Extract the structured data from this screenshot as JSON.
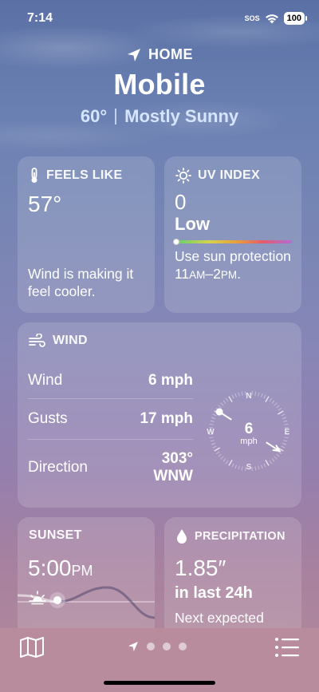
{
  "status_bar": {
    "time": "7:14",
    "sos": "SOS",
    "battery": "100"
  },
  "header": {
    "location_label": "HOME",
    "city": "Mobile",
    "temperature": "60°",
    "condition": "Mostly Sunny"
  },
  "feels_like": {
    "title": "FEELS LIKE",
    "value": "57°",
    "description": "Wind is making it feel cooler."
  },
  "uv_index": {
    "title": "UV INDEX",
    "value": "0",
    "level": "Low",
    "level_fraction": 0,
    "description_line1": "Use sun protection",
    "time_start": "11",
    "time_start_suffix": "AM",
    "dash": "–",
    "time_end": "2",
    "time_end_suffix": "PM",
    "period": "."
  },
  "wind": {
    "title": "WIND",
    "rows": [
      {
        "label": "Wind",
        "value": "6 mph"
      },
      {
        "label": "Gusts",
        "value": "17 mph"
      },
      {
        "label": "Direction",
        "value": "303°",
        "value2": "WNW"
      }
    ],
    "compass": {
      "speed": "6",
      "unit": "mph",
      "N": "N",
      "E": "E",
      "S": "S",
      "W": "W",
      "direction_degrees": 303
    }
  },
  "sunset": {
    "title": "SUNSET",
    "time": "5:00",
    "suffix": "PM"
  },
  "precipitation": {
    "title": "PRECIPITATION",
    "value": "1.85″",
    "period": "in last 24h",
    "next": "Next expected"
  },
  "colors": {
    "accent_condition": "#d6e5ff",
    "tab_bar": "#b88c9d"
  },
  "icons": {
    "location": "location-arrow-icon",
    "thermometer": "thermometer-icon",
    "sun": "sun-icon",
    "wind": "wind-icon",
    "sunset": "sunset-icon",
    "drop": "raindrop-icon",
    "map": "map-icon",
    "list": "list-icon"
  }
}
